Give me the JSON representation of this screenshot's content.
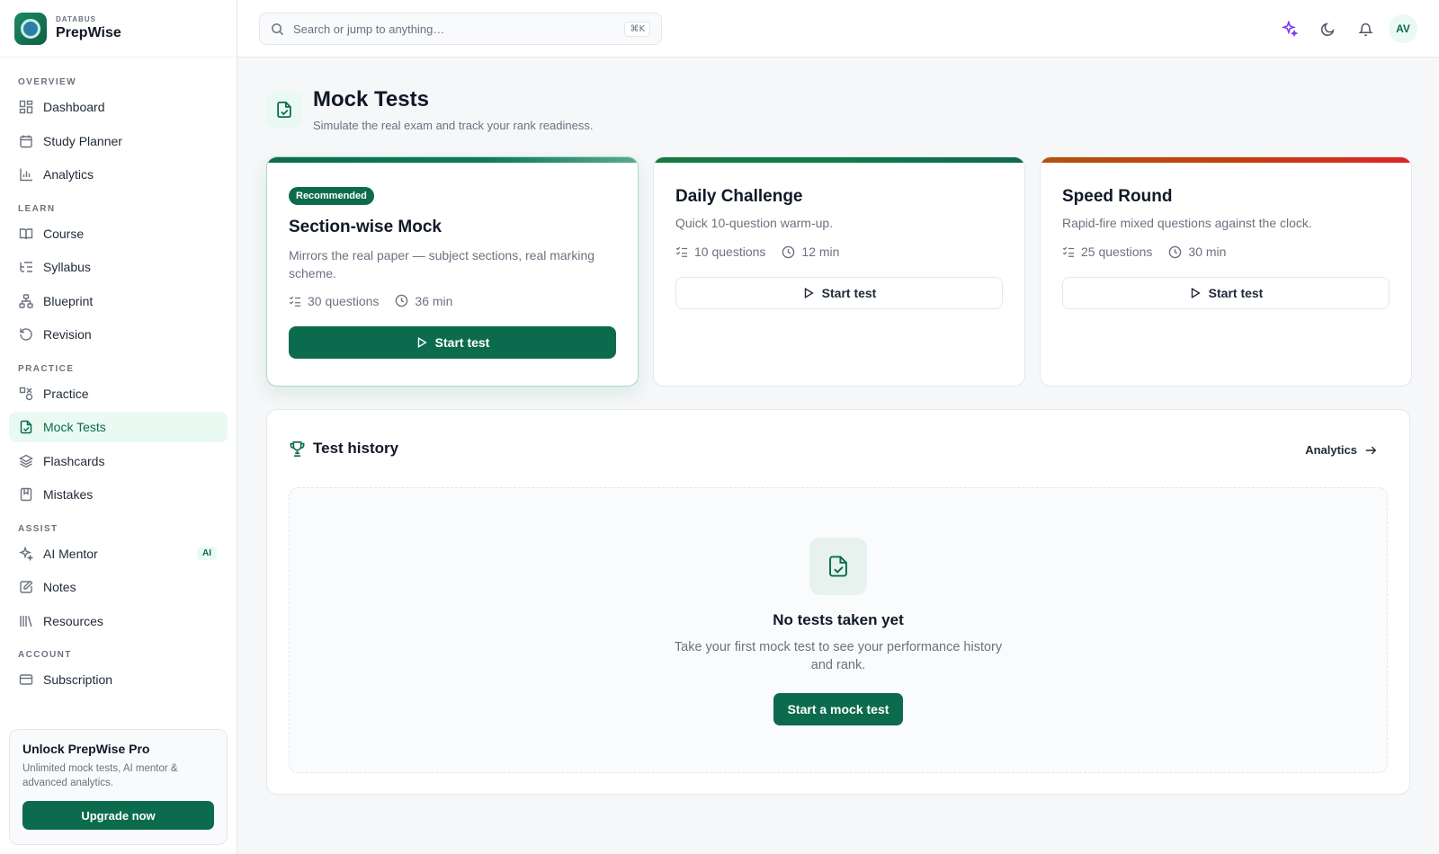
{
  "brand": {
    "kicker": "DATABUS",
    "name": "PrepWise"
  },
  "search": {
    "placeholder": "Search or jump to anything…",
    "shortcut": "⌘K"
  },
  "topbar": {
    "icons": [
      "sparkles-icon",
      "moon-icon",
      "bell-icon"
    ],
    "avatar": "AV"
  },
  "sidebar": {
    "sections": [
      {
        "title": "OVERVIEW",
        "items": [
          {
            "label": "Dashboard",
            "icon": "dashboard-icon"
          },
          {
            "label": "Study Planner",
            "icon": "calendar-icon"
          },
          {
            "label": "Analytics",
            "icon": "bar-chart-icon"
          }
        ]
      },
      {
        "title": "LEARN",
        "items": [
          {
            "label": "Course",
            "icon": "book-open-icon"
          },
          {
            "label": "Syllabus",
            "icon": "list-tree-icon"
          },
          {
            "label": "Blueprint",
            "icon": "network-icon"
          },
          {
            "label": "Revision",
            "icon": "rotate-icon"
          }
        ]
      },
      {
        "title": "PRACTICE",
        "items": [
          {
            "label": "Practice",
            "icon": "shapes-icon"
          },
          {
            "label": "Mock Tests",
            "icon": "file-check-icon",
            "active": true
          },
          {
            "label": "Flashcards",
            "icon": "layers-icon"
          },
          {
            "label": "Mistakes",
            "icon": "bookmark-book-icon"
          }
        ]
      },
      {
        "title": "ASSIST",
        "items": [
          {
            "label": "AI Mentor",
            "icon": "sparkles-icon",
            "badge": "AI"
          },
          {
            "label": "Notes",
            "icon": "notebook-pen-icon"
          },
          {
            "label": "Resources",
            "icon": "library-icon"
          }
        ]
      },
      {
        "title": "ACCOUNT",
        "items": [
          {
            "label": "Subscription",
            "icon": "credit-card-icon"
          }
        ]
      }
    ],
    "promo": {
      "title": "Unlock PrepWise Pro",
      "subtitle": "Unlimited mock tests, AI mentor & advanced analytics.",
      "button": "Upgrade now"
    }
  },
  "page": {
    "title": "Mock Tests",
    "subtitle": "Simulate the real exam and track your rank readiness."
  },
  "cards": [
    {
      "badge": "Recommended",
      "title": "Section-wise Mock",
      "description": "Mirrors the real paper — subject sections, real marking scheme.",
      "questions": "30 questions",
      "time": "36 min",
      "button": "Start test",
      "accent": "#0d6b4d"
    },
    {
      "title": "Daily Challenge",
      "description": "Quick 10-question warm-up.",
      "questions": "10 questions",
      "time": "12 min",
      "button": "Start test",
      "accent": "#0f7a4a"
    },
    {
      "title": "Speed Round",
      "description": "Rapid-fire mixed questions against the clock.",
      "questions": "25 questions",
      "time": "30 min",
      "button": "Start test",
      "accent": "#c2410c"
    }
  ],
  "history": {
    "title": "Test history",
    "link": "Analytics",
    "empty": {
      "title": "No tests taken yet",
      "subtitle": "Take your first mock test to see your performance history and rank.",
      "button": "Start a mock test"
    }
  },
  "colors": {
    "primary": "#0d6b4d",
    "primary_soft": "#eafaf2",
    "ai_accent": "#7c3aed"
  }
}
